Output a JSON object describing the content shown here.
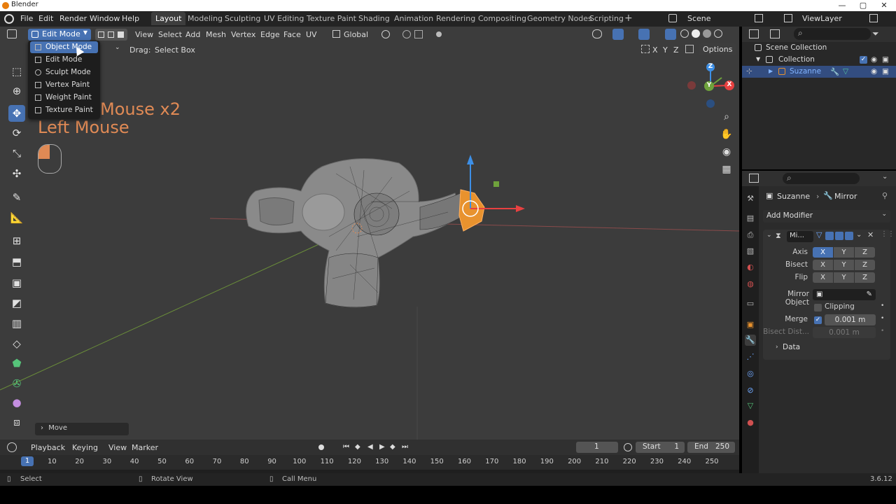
{
  "window": {
    "title": "Blender",
    "controls": [
      "—",
      "▢",
      "✕"
    ]
  },
  "menubar": {
    "items": [
      "File",
      "Edit",
      "Render",
      "Window",
      "Help"
    ]
  },
  "workspaces": {
    "tabs": [
      "Layout",
      "Modeling",
      "Sculpting",
      "UV Editing",
      "Texture Paint",
      "Shading",
      "Animation",
      "Rendering",
      "Compositing",
      "Geometry Nodes",
      "Scripting"
    ],
    "active": "Layout",
    "add": "+"
  },
  "scene": {
    "name": "Scene",
    "view_layer": "ViewLayer"
  },
  "viewport": {
    "mode": "Edit Mode",
    "menus": [
      "View",
      "Select",
      "Add",
      "Mesh",
      "Vertex",
      "Edge",
      "Face",
      "UV"
    ],
    "orientation": "Global",
    "drag_label": "Drag:",
    "drag_value": "Select Box",
    "axis_toggles": [
      "X",
      "Y",
      "Z"
    ],
    "options": "Options",
    "mode_menu": [
      "Object Mode",
      "Edit Mode",
      "Sculpt Mode",
      "Vertex Paint",
      "Weight Paint",
      "Texture Paint"
    ],
    "highlighted_mode": "Object Mode",
    "key_overlay_1": "Mouse x2",
    "key_overlay_2": "Left Mouse",
    "last_op": "Move",
    "gizmo": {
      "x": "X",
      "y": "Y",
      "z": "Z"
    }
  },
  "timeline": {
    "menus": [
      "Playback",
      "Keying",
      "View",
      "Marker"
    ],
    "current_frame": "1",
    "start_label": "Start",
    "start": "1",
    "end_label": "End",
    "end": "250",
    "ruler": [
      "10",
      "20",
      "30",
      "40",
      "50",
      "60",
      "70",
      "80",
      "90",
      "100",
      "110",
      "120",
      "130",
      "140",
      "150",
      "160",
      "170",
      "180",
      "190",
      "200",
      "210",
      "220",
      "230",
      "240",
      "250"
    ]
  },
  "statusbar": {
    "select": "Select",
    "rotate": "Rotate View",
    "menu": "Call Menu",
    "version": "3.6.12"
  },
  "outliner": {
    "root": "Scene Collection",
    "collection": "Collection",
    "object": "Suzanne"
  },
  "properties": {
    "object": "Suzanne",
    "modifier_breadcrumb": "Mirror",
    "add_modifier": "Add Modifier",
    "modifier_name": "Mi...",
    "axis_label": "Axis",
    "bisect_label": "Bisect",
    "flip_label": "Flip",
    "xyz": [
      "X",
      "Y",
      "Z"
    ],
    "mirror_object_label": "Mirror Object",
    "clipping_label": "Clipping",
    "merge_label": "Merge",
    "merge_value": "0.001 m",
    "bisect_dist_label": "Bisect Dist...",
    "bisect_dist_value": "0.001 m",
    "data_label": "Data"
  },
  "colors": {
    "accent": "#4772b3",
    "selection": "#e8922e",
    "background": "#3c3c3c"
  }
}
